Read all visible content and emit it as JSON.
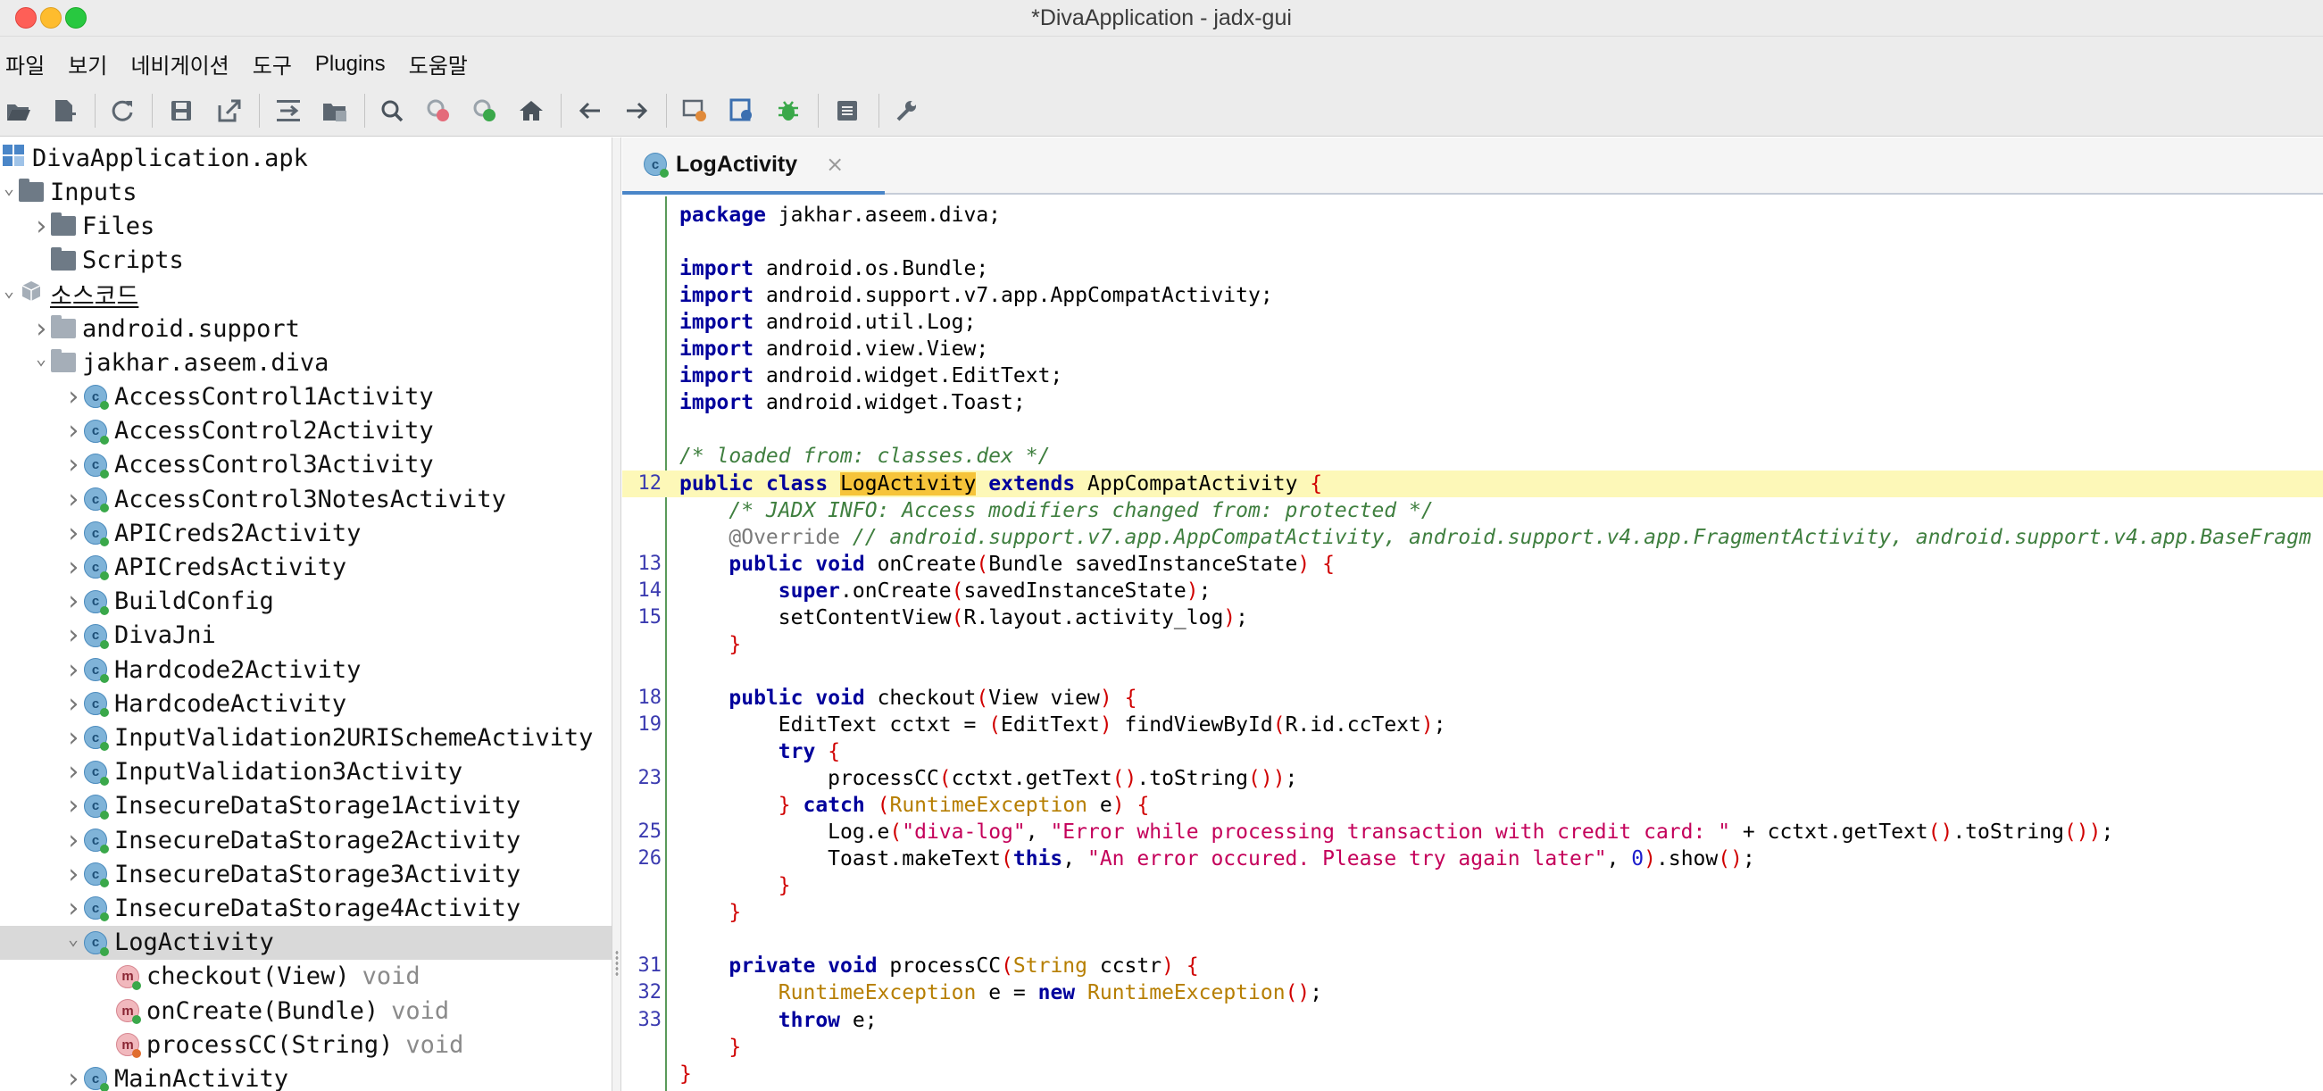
{
  "window": {
    "title": "*DivaApplication - jadx-gui"
  },
  "menu": [
    "파일",
    "보기",
    "네비게이션",
    "도구",
    "Plugins",
    "도움말"
  ],
  "toolbar": {
    "icons": [
      "open-file-icon",
      "add-files-icon",
      "reload-icon",
      "save-icon",
      "export-icon",
      "sync-tree-icon",
      "flatten-packages-icon",
      "search-icon",
      "find-class-icon",
      "find-usage-icon",
      "home-icon",
      "back-icon",
      "forward-icon",
      "deobfuscation-icon",
      "decompile-all-icon",
      "debugger-icon",
      "log-viewer-icon",
      "preferences-icon"
    ]
  },
  "tree": [
    {
      "label": "DivaApplication.apk",
      "indent": 0,
      "icon": "apk",
      "chev": ""
    },
    {
      "label": "Inputs",
      "indent": 0,
      "icon": "folder-dark",
      "chev": "down"
    },
    {
      "label": "Files",
      "indent": 1,
      "icon": "folder-dark",
      "chev": "right"
    },
    {
      "label": "Scripts",
      "indent": 1,
      "icon": "folder-dark",
      "chev": ""
    },
    {
      "label": "소스코드",
      "indent": 0,
      "icon": "package-box",
      "chev": "down",
      "underline": true
    },
    {
      "label": "android.support",
      "indent": 1,
      "icon": "folder-light",
      "chev": "right"
    },
    {
      "label": "jakhar.aseem.diva",
      "indent": 1,
      "icon": "folder-light",
      "chev": "down"
    },
    {
      "label": "AccessControl1Activity",
      "indent": 2,
      "icon": "class",
      "chev": "right"
    },
    {
      "label": "AccessControl2Activity",
      "indent": 2,
      "icon": "class",
      "chev": "right"
    },
    {
      "label": "AccessControl3Activity",
      "indent": 2,
      "icon": "class",
      "chev": "right"
    },
    {
      "label": "AccessControl3NotesActivity",
      "indent": 2,
      "icon": "class",
      "chev": "right"
    },
    {
      "label": "APICreds2Activity",
      "indent": 2,
      "icon": "class",
      "chev": "right"
    },
    {
      "label": "APICredsActivity",
      "indent": 2,
      "icon": "class",
      "chev": "right"
    },
    {
      "label": "BuildConfig",
      "indent": 2,
      "icon": "class",
      "chev": "right"
    },
    {
      "label": "DivaJni",
      "indent": 2,
      "icon": "class",
      "chev": "right"
    },
    {
      "label": "Hardcode2Activity",
      "indent": 2,
      "icon": "class",
      "chev": "right"
    },
    {
      "label": "HardcodeActivity",
      "indent": 2,
      "icon": "class",
      "chev": "right"
    },
    {
      "label": "InputValidation2URISchemeActivity",
      "indent": 2,
      "icon": "class",
      "chev": "right"
    },
    {
      "label": "InputValidation3Activity",
      "indent": 2,
      "icon": "class",
      "chev": "right"
    },
    {
      "label": "InsecureDataStorage1Activity",
      "indent": 2,
      "icon": "class",
      "chev": "right"
    },
    {
      "label": "InsecureDataStorage2Activity",
      "indent": 2,
      "icon": "class",
      "chev": "right"
    },
    {
      "label": "InsecureDataStorage3Activity",
      "indent": 2,
      "icon": "class",
      "chev": "right"
    },
    {
      "label": "InsecureDataStorage4Activity",
      "indent": 2,
      "icon": "class",
      "chev": "right"
    },
    {
      "label": "LogActivity",
      "indent": 2,
      "icon": "class",
      "chev": "down",
      "selected": true
    },
    {
      "label": "checkout(View)",
      "ret": "void",
      "indent": 3,
      "icon": "method-pub",
      "chev": ""
    },
    {
      "label": "onCreate(Bundle)",
      "ret": "void",
      "indent": 3,
      "icon": "method-pub",
      "chev": ""
    },
    {
      "label": "processCC(String)",
      "ret": "void",
      "indent": 3,
      "icon": "method-priv",
      "chev": ""
    },
    {
      "label": "MainActivity",
      "indent": 2,
      "icon": "class",
      "chev": "right"
    }
  ],
  "editor": {
    "tab_label": "LogActivity",
    "tab_close": "×",
    "lines": [
      {
        "n": "",
        "html": "<span class='kw'>package</span> jakhar.aseem.diva;"
      },
      {
        "n": "",
        "html": ""
      },
      {
        "n": "",
        "html": "<span class='kw'>import</span> android.os.Bundle;"
      },
      {
        "n": "",
        "html": "<span class='kw'>import</span> android.support.v7.app.AppCompatActivity;"
      },
      {
        "n": "",
        "html": "<span class='kw'>import</span> android.util.Log;"
      },
      {
        "n": "",
        "html": "<span class='kw'>import</span> android.view.View;"
      },
      {
        "n": "",
        "html": "<span class='kw'>import</span> android.widget.EditText;"
      },
      {
        "n": "",
        "html": "<span class='kw'>import</span> android.widget.Toast;"
      },
      {
        "n": "",
        "html": ""
      },
      {
        "n": "",
        "html": "<span class='cm'>/* loaded from: classes.dex */</span>"
      },
      {
        "n": "12",
        "hl": true,
        "html": "<span class='kw'>public</span> <span class='kw'>class</span> <span class='mark'>LogActivity</span> <span class='kw'>extends</span> AppCompatActivity <span class='br'>{</span>"
      },
      {
        "n": "",
        "html": "    <span class='cm'>/* JADX INFO: Access modifiers changed from: protected */</span>"
      },
      {
        "n": "",
        "html": "    <span class='an'>@Override</span> <span class='cm'>// android.support.v7.app.AppCompatActivity, android.support.v4.app.FragmentActivity, android.support.v4.app.BaseFragm</span>"
      },
      {
        "n": "13",
        "html": "    <span class='kw'>public</span> <span class='kw'>void</span> onCreate<span class='br'>(</span>Bundle savedInstanceState<span class='br'>)</span> <span class='br'>{</span>"
      },
      {
        "n": "14",
        "html": "        <span class='kw'>super</span>.onCreate<span class='br'>(</span>savedInstanceState<span class='br'>)</span>;"
      },
      {
        "n": "15",
        "html": "        setContentView<span class='br'>(</span>R.layout.activity_log<span class='br'>)</span>;"
      },
      {
        "n": "",
        "html": "    <span class='br'>}</span>"
      },
      {
        "n": "",
        "html": ""
      },
      {
        "n": "18",
        "html": "    <span class='kw'>public</span> <span class='kw'>void</span> checkout<span class='br'>(</span>View view<span class='br'>)</span> <span class='br'>{</span>"
      },
      {
        "n": "19",
        "html": "        EditText cctxt = <span class='br'>(</span>EditText<span class='br'>)</span> findViewById<span class='br'>(</span>R.id.ccText<span class='br'>)</span>;"
      },
      {
        "n": "",
        "html": "        <span class='kw'>try</span> <span class='br'>{</span>"
      },
      {
        "n": "23",
        "html": "            processCC<span class='br'>(</span>cctxt.getText<span class='br'>()</span>.toString<span class='br'>())</span>;"
      },
      {
        "n": "",
        "html": "        <span class='br'>}</span> <span class='kw'>catch</span> <span class='br'>(</span><span class='ty'>RuntimeException</span> e<span class='br'>)</span> <span class='br'>{</span>"
      },
      {
        "n": "25",
        "html": "            Log.e<span class='br'>(</span><span class='st'>\"diva-log\"</span>, <span class='st'>\"Error while processing transaction with credit card: \"</span> + cctxt.getText<span class='br'>()</span>.toString<span class='br'>())</span>;"
      },
      {
        "n": "26",
        "html": "            Toast.makeText<span class='br'>(</span><span class='kw'>this</span>, <span class='st'>\"An error occured. Please try again later\"</span>, <span class='num'>0</span><span class='br'>)</span>.show<span class='br'>()</span>;"
      },
      {
        "n": "",
        "html": "        <span class='br'>}</span>"
      },
      {
        "n": "",
        "html": "    <span class='br'>}</span>"
      },
      {
        "n": "",
        "html": ""
      },
      {
        "n": "31",
        "html": "    <span class='kw'>private</span> <span class='kw'>void</span> processCC<span class='br'>(</span><span class='ty'>String</span> ccstr<span class='br'>)</span> <span class='br'>{</span>"
      },
      {
        "n": "32",
        "html": "        <span class='ty'>RuntimeException</span> e = <span class='kw'>new</span> <span class='ty'>RuntimeException</span><span class='br'>()</span>;"
      },
      {
        "n": "33",
        "html": "        <span class='kw'>throw</span> e;"
      },
      {
        "n": "",
        "html": "    <span class='br'>}</span>"
      },
      {
        "n": "",
        "html": "<span class='br'>}</span>"
      }
    ]
  }
}
